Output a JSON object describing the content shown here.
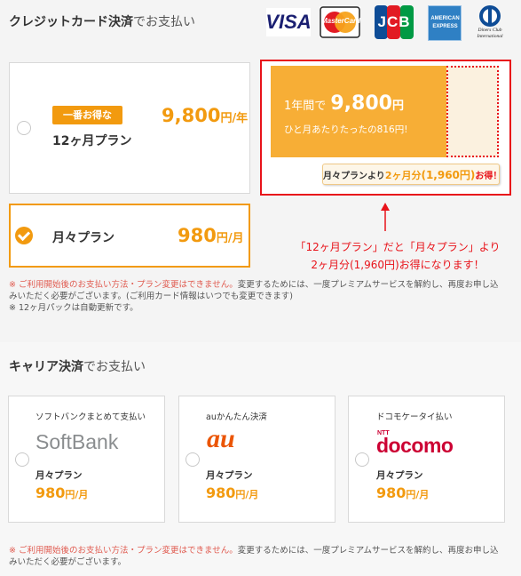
{
  "credit": {
    "title_main": "クレジットカード決済",
    "title_sub": "でお支払い",
    "brands": [
      {
        "name": "VISA"
      },
      {
        "name": "MasterCard"
      },
      {
        "name": "JCB"
      },
      {
        "name": "AMERICAN EXPRESS"
      },
      {
        "name": "Diners Club International"
      }
    ]
  },
  "plan12": {
    "badge": "一番お得な",
    "name": "12ヶ月プラン",
    "price": "9,800",
    "unit": "円/年"
  },
  "monthly": {
    "name": "月々プラン",
    "price": "980",
    "unit": "円/月"
  },
  "promo": {
    "year_prefix": "1年間で",
    "year_price": "9,800",
    "year_unit": "円",
    "per_month": "ひと月あたりたったの816円!",
    "saving_prefix": "月々プランより",
    "saving_months": "2ヶ月分",
    "saving_amount": "(1,960円)",
    "saving_suffix": "お得！"
  },
  "annotation": {
    "line1": "「12ヶ月プラン」だと「月々プラン」より",
    "line2": "2ヶ月分(1,960円)お得になります！"
  },
  "notes": {
    "red": "※ ご利用開始後のお支払い方法・プラン変更はできません。",
    "rest": "変更するためには、一度プレミアムサービスを解約し、再度お申し込みいただく必要がございます。(ご利用カード情報はいつでも変更できます)",
    "line3": "※ 12ヶ月パックは自動更新です。"
  },
  "carrier": {
    "title_main": "キャリア決済",
    "title_sub": "でお支払い",
    "cards": [
      {
        "label": "ソフトバンクまとめて支払い",
        "logo": "SoftBank",
        "plan": "月々プラン",
        "price": "980",
        "unit": "円/月"
      },
      {
        "label": "auかんたん決済",
        "logo": "au",
        "plan": "月々プラン",
        "price": "980",
        "unit": "円/月"
      },
      {
        "label": "ドコモケータイ払い",
        "logo_small": "NTT",
        "logo": "docomo",
        "plan": "月々プラン",
        "price": "980",
        "unit": "円/月"
      }
    ]
  },
  "bottom_note": {
    "red": "※ ご利用開始後のお支払い方法・プラン変更はできません。",
    "rest": "変更するためには、一度プレミアムサービスを解約し、再度お申し込みいただく必要がございます。"
  }
}
